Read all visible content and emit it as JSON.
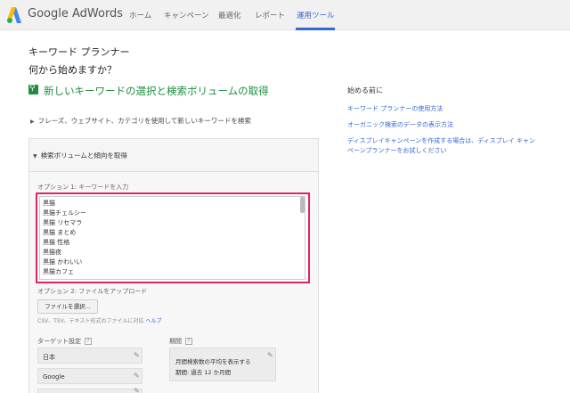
{
  "header": {
    "brand": "Google AdWords",
    "nav": [
      {
        "label": "ホーム",
        "active": false
      },
      {
        "label": "キャンペーン",
        "active": false
      },
      {
        "label": "最適化",
        "active": false
      },
      {
        "label": "レポート",
        "active": false
      },
      {
        "label": "運用ツール",
        "active": true
      }
    ],
    "accent_color": "#3367d6"
  },
  "page": {
    "title": "キーワード プランナー",
    "subtitle": "何から始めますか？",
    "section_title": "新しいキーワードの選択と検索ボリュームの取得",
    "section_color": "#1e8e3e",
    "collapsed_option": "フレーズ、ウェブサイト、カテゴリを使用して新しいキーワードを検索",
    "panel_title": "検索ボリュームと傾向を取得"
  },
  "option1": {
    "label": "オプション 1: キーワードを入力",
    "keywords": [
      "黒猫",
      "黒猫チェルシー",
      "黒猫 リセマラ",
      "黒猫 まとめ",
      "黒猫 性格",
      "黒猫夜",
      "黒猫 かわいい",
      "黒猫カフェ"
    ],
    "highlight_color": "#e0245e"
  },
  "option2": {
    "label": "オプション 2: ファイルをアップロード",
    "button": "ファイルを選択...",
    "help_text": "CSV、TSV、テキスト形式のファイルに対応",
    "help_link": "ヘルプ"
  },
  "targeting": {
    "label": "ターゲット設定",
    "help": "?",
    "fields": [
      "日本",
      "Google",
      ""
    ]
  },
  "period": {
    "label": "期間",
    "help": "?",
    "line1": "月間検索数の平均を表示する",
    "line2": "期間: 過去 12 か月間"
  },
  "sidebar": {
    "title": "始める前に",
    "links": [
      "キーワード プランナーの使用方法",
      "オーガニック検索のデータの表示方法",
      "ディスプレイキャンペーンを作成する場合は、ディスプレイ キャン",
      "ペーンプランナーをお試しください"
    ]
  }
}
